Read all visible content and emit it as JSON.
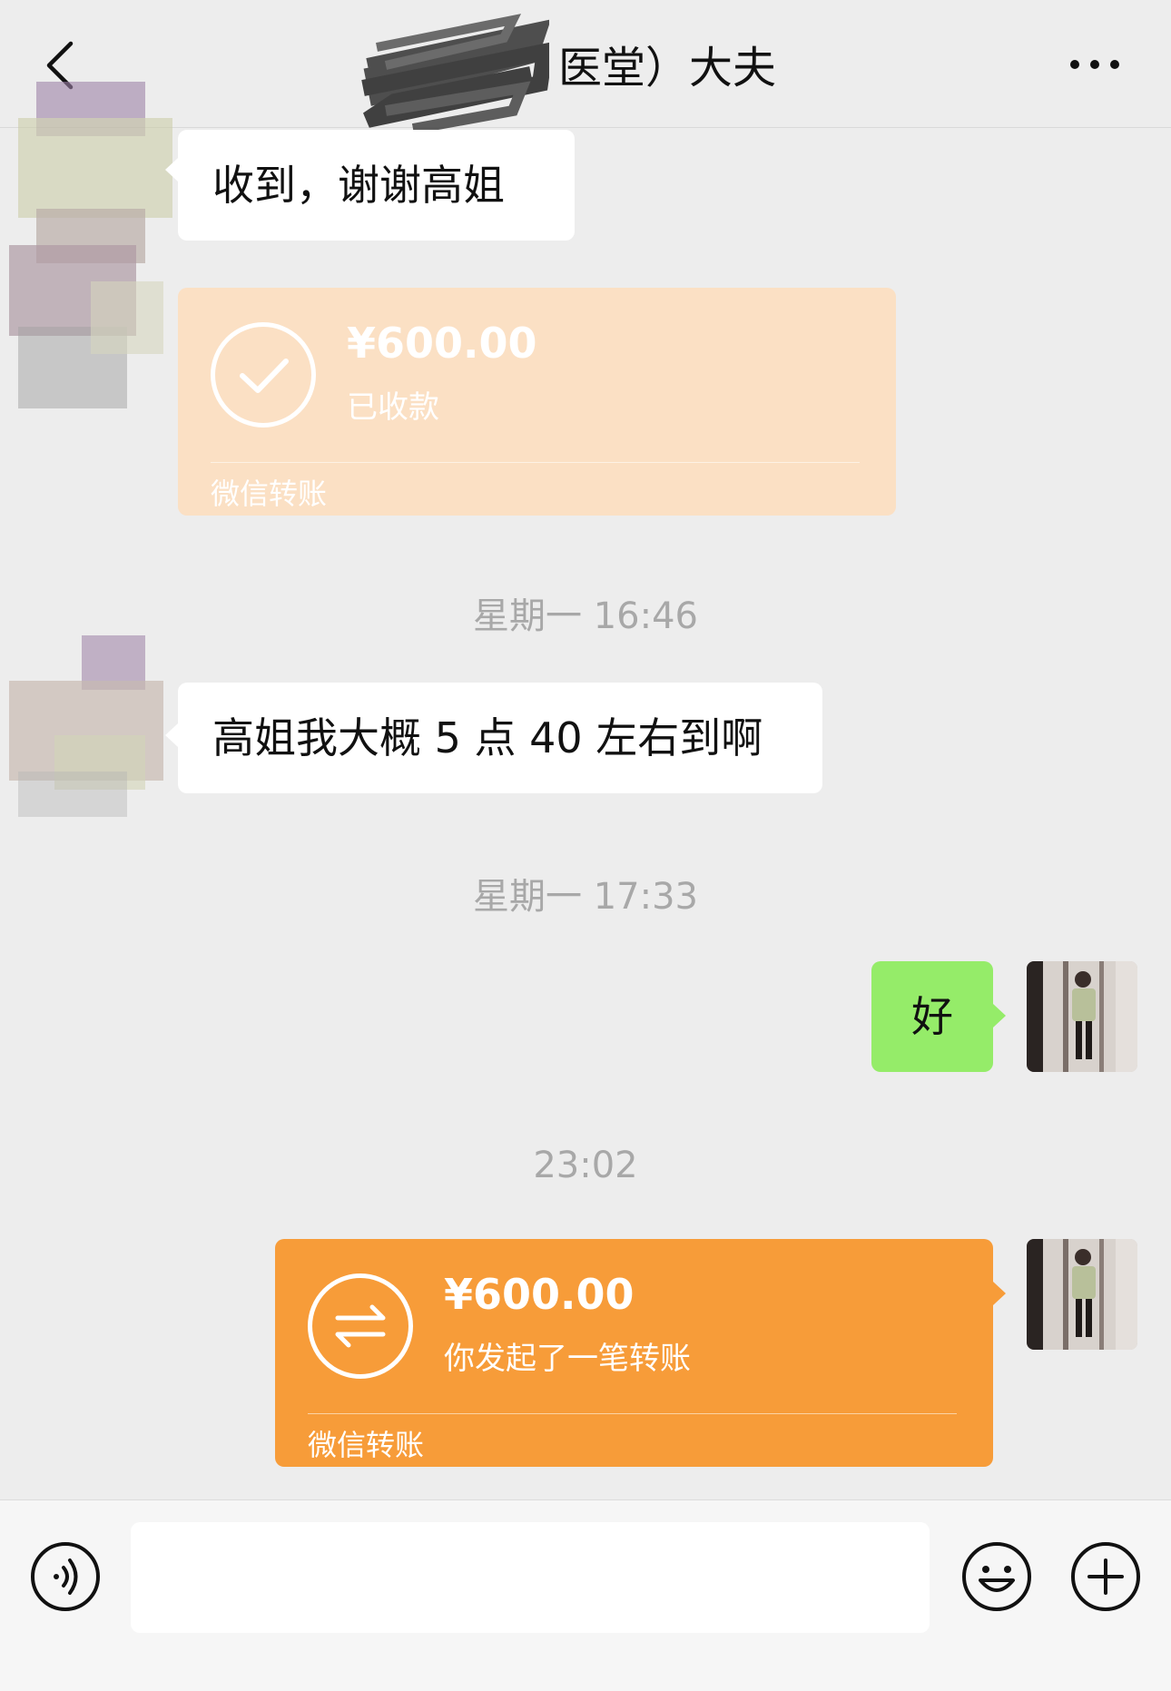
{
  "header": {
    "title": "医堂）大夫",
    "back_icon": "chevron-left-icon",
    "more_icon": "more-dots-icon"
  },
  "messages": {
    "m1_text": "收到，谢谢高姐",
    "m2": {
      "amount": "¥600.00",
      "status": "已收款",
      "label": "微信转账"
    },
    "t1": "星期一 16:46",
    "m3_text": "高姐我大概 5 点 40 左右到啊",
    "t2": "星期一 17:33",
    "m4_text": "好",
    "t3": "23:02",
    "m5": {
      "amount": "¥600.00",
      "status": "你发起了一笔转账",
      "label": "微信转账"
    }
  },
  "input_bar": {
    "text_value": "",
    "voice_icon": "voice-icon",
    "emoji_icon": "emoji-icon",
    "plus_icon": "plus-icon"
  },
  "colors": {
    "background": "#ededed",
    "green_bubble": "#95ec69",
    "received_transfer": "#fbe0c4",
    "sent_transfer": "#f79c39",
    "timestamp": "#a8a8a8"
  }
}
